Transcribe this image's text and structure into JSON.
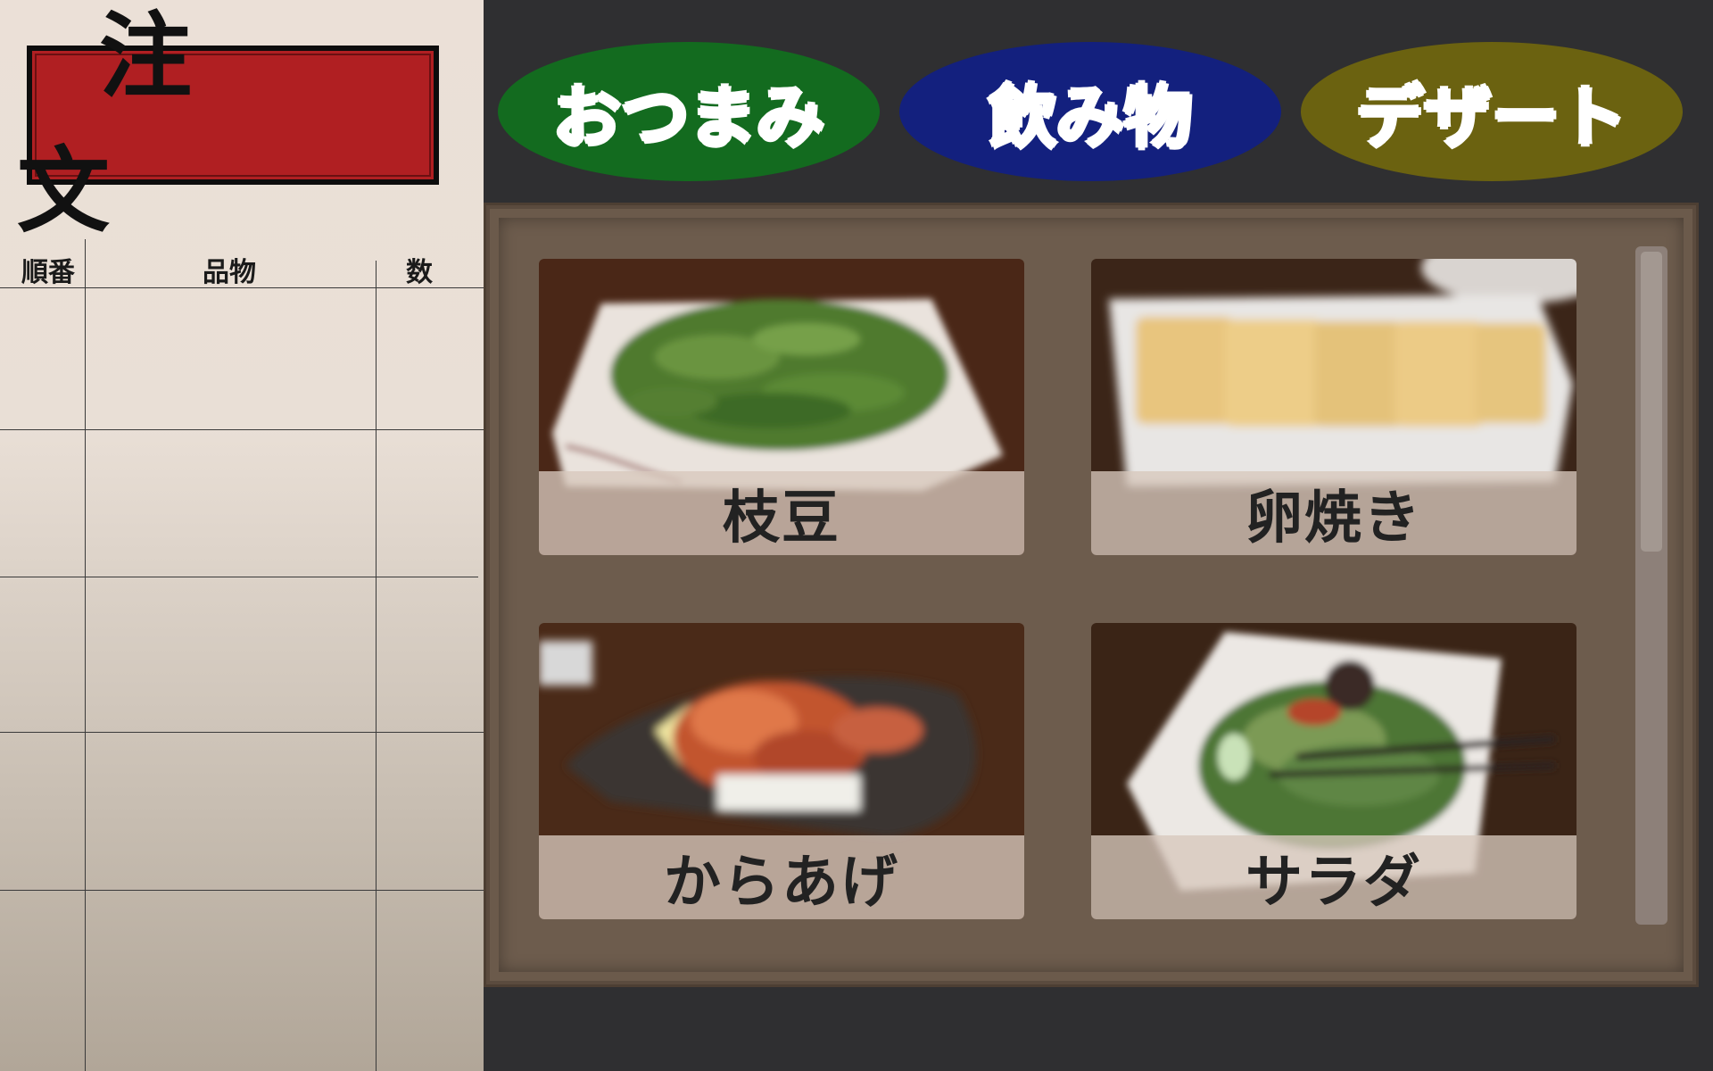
{
  "order_sheet": {
    "title": "注　文",
    "columns": [
      "順番",
      "品物",
      "数"
    ],
    "rows": 5
  },
  "tabs": [
    {
      "label": "おつまみ",
      "color": "#136b1f"
    },
    {
      "label": "飲み物",
      "color": "#13207e"
    },
    {
      "label": "デザート",
      "color": "#6b6210"
    }
  ],
  "menu_items": [
    {
      "label": "枝豆"
    },
    {
      "label": "卵焼き"
    },
    {
      "label": "からあげ"
    },
    {
      "label": "サラダ"
    }
  ],
  "colors": {
    "title_red": "#b01f22",
    "panel_brown": "#6b5a4b",
    "background": "#2f2f31"
  }
}
